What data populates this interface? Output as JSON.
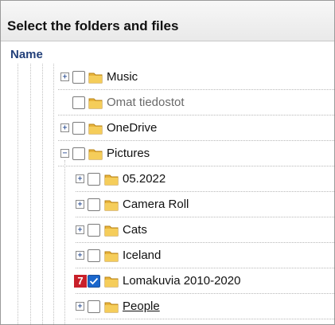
{
  "panel": {
    "title": "Select the folders and files",
    "column_header": "Name"
  },
  "tree": [
    {
      "label": "Music",
      "expander": "plus",
      "checked": false,
      "muted": false
    },
    {
      "label": "Omat tiedostot",
      "expander": "none",
      "checked": false,
      "muted": true
    },
    {
      "label": "OneDrive",
      "expander": "plus",
      "checked": false,
      "muted": false
    },
    {
      "label": "Pictures",
      "expander": "minus",
      "checked": false,
      "muted": false
    },
    {
      "label": "05.2022",
      "expander": "plus",
      "checked": false,
      "muted": false
    },
    {
      "label": "Camera Roll",
      "expander": "plus",
      "checked": false,
      "muted": false
    },
    {
      "label": "Cats",
      "expander": "plus",
      "checked": false,
      "muted": false
    },
    {
      "label": "Iceland",
      "expander": "plus",
      "checked": false,
      "muted": false
    },
    {
      "label": "Lomakuvia 2010-2020",
      "expander": "none",
      "checked": true,
      "muted": false,
      "badge": "7"
    },
    {
      "label": "People",
      "expander": "plus",
      "checked": false,
      "muted": false
    }
  ],
  "glyphs": {
    "plus": "+",
    "minus": "−"
  },
  "colors": {
    "folder": "#e8b33a",
    "checked": "#1a66cc",
    "badge": "#c8202a",
    "header_text": "#23407a"
  },
  "icons": [
    "expand-icon",
    "collapse-icon",
    "folder-icon",
    "checkmark-icon"
  ]
}
